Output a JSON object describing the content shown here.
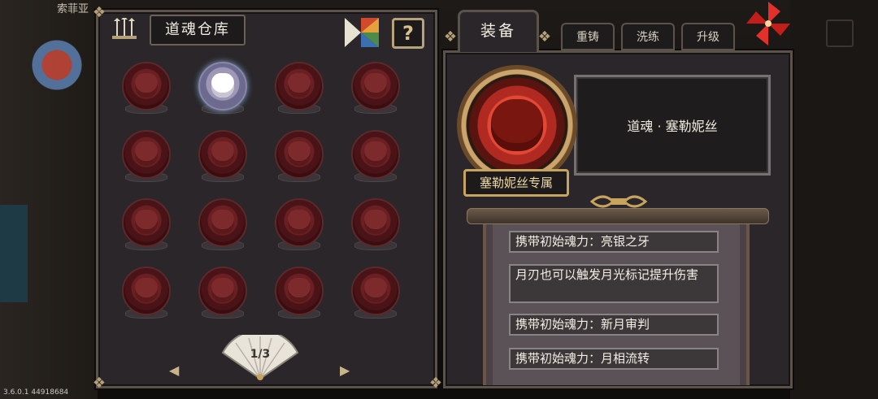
{
  "background": {
    "npc_name": "索菲亚",
    "version": "3.6.0.1 44918684"
  },
  "warehouse": {
    "title": "道魂仓库",
    "help_label": "?",
    "page": "1/3",
    "prev_icon": "arrow-left-icon",
    "next_icon": "arrow-right-icon",
    "soul_count": 16,
    "selected_index": 1
  },
  "tabs": {
    "equip": "装备",
    "recast": "重铸",
    "refine": "洗练",
    "upgrade": "升级"
  },
  "equipped": {
    "name": "道魂 · 塞勒妮丝",
    "exclusive": "塞勒妮丝专属",
    "effects": [
      "携带初始魂力：亮银之牙",
      "月刃也可以触发月光标记提升伤害",
      "携带初始魂力：新月审判",
      "携带初始魂力：月相流转"
    ]
  },
  "colors": {
    "panel": "#2a2629",
    "border": "#5b524a",
    "gold": "#c6a45e",
    "orb_red": "#b02a22"
  }
}
